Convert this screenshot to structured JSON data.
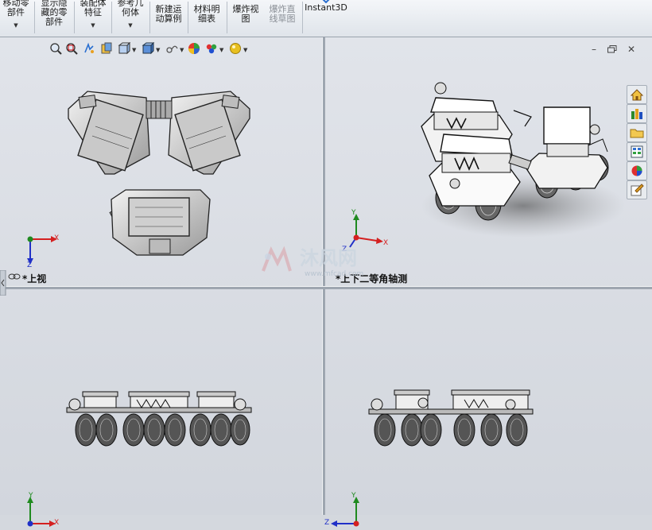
{
  "ribbon": {
    "buttons": [
      {
        "label1": "移动零",
        "label2": "部件",
        "label3": "",
        "dropdown": true,
        "enabled": true
      },
      {
        "label1": "显示隐",
        "label2": "藏的零",
        "label3": "部件",
        "dropdown": false,
        "enabled": true
      },
      {
        "label1": "装配体",
        "label2": "特征",
        "label3": "",
        "dropdown": true,
        "enabled": true
      },
      {
        "label1": "参考几",
        "label2": "何体",
        "label3": "",
        "dropdown": true,
        "enabled": true
      },
      {
        "label1": "新建运",
        "label2": "动算例",
        "label3": "",
        "dropdown": false,
        "enabled": true
      },
      {
        "label1": "材料明",
        "label2": "细表",
        "label3": "",
        "dropdown": false,
        "enabled": true
      },
      {
        "label1": "爆炸视",
        "label2": "图",
        "label3": "",
        "dropdown": false,
        "enabled": true
      },
      {
        "label1": "爆炸直",
        "label2": "线草图",
        "label3": "",
        "dropdown": false,
        "enabled": false
      },
      {
        "label1": "Instant3D",
        "label2": "",
        "label3": "",
        "dropdown": false,
        "enabled": true
      }
    ]
  },
  "viewports": {
    "top_left": {
      "name": "*上视"
    },
    "top_right": {
      "name": "*上下二等角轴测"
    },
    "bottom_left": {
      "name": ""
    },
    "bottom_right": {
      "name": ""
    }
  },
  "triad_labels": {
    "x": "X",
    "y": "Y",
    "z": "Z"
  },
  "watermark": {
    "text": "沐风网",
    "url": "www.mfcad.com"
  },
  "colors": {
    "axis_x": "#d42020",
    "axis_y": "#1f8a1f",
    "axis_z": "#2030c8",
    "viewport_bg": "#d8dce2",
    "ribbon_bg": "#e8ecf0"
  },
  "heads_up_icons": [
    "zoom-to-fit-icon",
    "zoom-area-icon",
    "previous-view-icon",
    "section-view-icon",
    "view-orientation-icon",
    "display-style-icon",
    "hide-show-items-icon",
    "edit-appearance-icon",
    "apply-scene-icon",
    "view-settings-icon"
  ],
  "task_pane_icons": [
    "home-icon",
    "design-library-icon",
    "file-explorer-icon",
    "view-palette-icon",
    "appearances-icon",
    "custom-properties-icon"
  ]
}
